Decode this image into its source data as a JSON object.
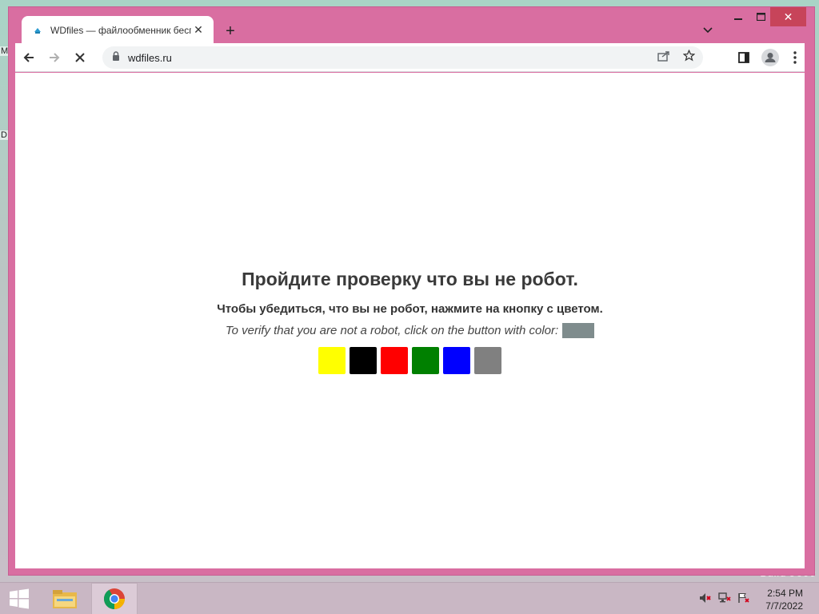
{
  "browser": {
    "tab_title": "WDfiles — файлообменник бесплатно",
    "new_tab_symbol": "+",
    "url": "wdfiles.ru",
    "accent": "#d96ea1"
  },
  "desktop": {
    "build_text": "Build 9600",
    "left_fragment_1": "M",
    "left_fragment_2": "D"
  },
  "page": {
    "heading": "Пройдите проверку что вы не робот.",
    "subtitle": "Чтобы убедиться, что вы не робот, нажмите на кнопку с цветом.",
    "english": "To verify that you are not a robot, click on the button with color:",
    "target_color": "#7f8c8d",
    "color_buttons": [
      {
        "name": "yellow",
        "color": "#ffff00"
      },
      {
        "name": "black",
        "color": "#000000"
      },
      {
        "name": "red",
        "color": "#ff0000"
      },
      {
        "name": "green",
        "color": "#008000"
      },
      {
        "name": "blue",
        "color": "#0000ff"
      },
      {
        "name": "gray",
        "color": "#808080"
      }
    ]
  },
  "taskbar": {
    "time": "2:54 PM",
    "date": "7/7/2022"
  }
}
